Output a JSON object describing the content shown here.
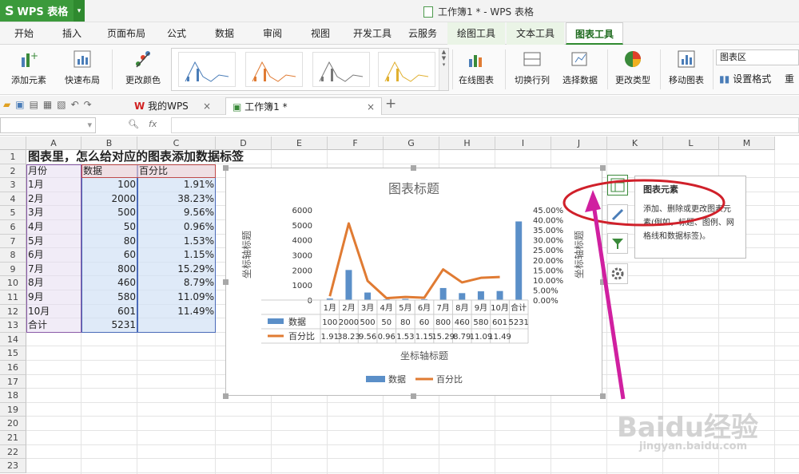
{
  "app": {
    "name": "WPS 表格",
    "window_title": "工作簿1 * - WPS 表格"
  },
  "menu_tabs": [
    "开始",
    "插入",
    "页面布局",
    "公式",
    "数据",
    "审阅",
    "视图",
    "开发工具",
    "云服务",
    "绘图工具",
    "文本工具",
    "图表工具"
  ],
  "ribbon": {
    "add_element": "添加元素",
    "quick_layout": "快速布局",
    "change_color": "更改颜色",
    "online_chart": "在线图表",
    "switch_row_col": "切换行列",
    "select_data": "选择数据",
    "change_type": "更改类型",
    "move_chart": "移动图表",
    "chart_area": "图表区",
    "set_format": "设置格式",
    "reset": "重"
  },
  "doc_tabs": {
    "my_wps": "我的WPS",
    "workbook": "工作簿1 *"
  },
  "formula": {
    "fx": "fx"
  },
  "columns": [
    "A",
    "B",
    "C",
    "D",
    "E",
    "F",
    "G",
    "H",
    "I",
    "J",
    "K",
    "L",
    "M"
  ],
  "rows": [
    "1",
    "2",
    "3",
    "4",
    "5",
    "6",
    "7",
    "8",
    "9",
    "10",
    "11",
    "12",
    "13",
    "14",
    "15",
    "16",
    "17",
    "18",
    "19",
    "20",
    "21",
    "22",
    "23"
  ],
  "sheet": {
    "title": "图表里，怎么给对应的图表添加数据标签",
    "headers": [
      "月份",
      "数据",
      "百分比"
    ],
    "data": [
      [
        "1月",
        "100",
        "1.91%"
      ],
      [
        "2月",
        "2000",
        "38.23%"
      ],
      [
        "3月",
        "500",
        "9.56%"
      ],
      [
        "4月",
        "50",
        "0.96%"
      ],
      [
        "5月",
        "80",
        "1.53%"
      ],
      [
        "6月",
        "60",
        "1.15%"
      ],
      [
        "7月",
        "800",
        "15.29%"
      ],
      [
        "8月",
        "460",
        "8.79%"
      ],
      [
        "9月",
        "580",
        "11.09%"
      ],
      [
        "10月",
        "601",
        "11.49%"
      ],
      [
        "合计",
        "5231",
        ""
      ]
    ]
  },
  "chart_data": {
    "type": "bar",
    "title": "图表标题",
    "xlabel": "坐标轴标题",
    "ylabel": "坐标轴标题",
    "y2label": "坐标轴标题",
    "categories": [
      "1月",
      "2月",
      "3月",
      "4月",
      "5月",
      "6月",
      "7月",
      "8月",
      "9月",
      "10月",
      "合计"
    ],
    "ylim": [
      0,
      6000
    ],
    "yticks": [
      "6000",
      "5000",
      "4000",
      "3000",
      "2000",
      "1000",
      "0"
    ],
    "y2lim": [
      0,
      45
    ],
    "y2ticks": [
      "45.00%",
      "40.00%",
      "35.00%",
      "30.00%",
      "25.00%",
      "20.00%",
      "15.00%",
      "10.00%",
      "5.00%",
      "0.00%"
    ],
    "series": [
      {
        "name": "数据",
        "type": "bar",
        "color": "#5b8fc8",
        "values": [
          100,
          2000,
          500,
          50,
          80,
          60,
          800,
          460,
          580,
          601,
          5231
        ]
      },
      {
        "name": "百分比",
        "type": "line",
        "color": "#e07b33",
        "values": [
          1.91,
          38.23,
          9.56,
          0.96,
          1.53,
          1.15,
          15.29,
          8.79,
          11.09,
          11.49
        ]
      }
    ],
    "table_rows": [
      [
        "100",
        "2000",
        "500",
        "50",
        "80",
        "60",
        "800",
        "460",
        "580",
        "601",
        "5231"
      ],
      [
        "1.91",
        "38.23",
        "9.56",
        "0.96",
        "1.53",
        "1.15",
        "15.29",
        "8.79",
        "11.09",
        "11.49",
        ""
      ]
    ]
  },
  "tooltip": {
    "title": "图表元素",
    "body": "添加、删除或更改图表元素(例如，标题、图例、网格线和数据标签)。"
  },
  "watermark": {
    "main": "Baidu经验",
    "url": "jingyan.baidu.com"
  },
  "colors": {
    "accent": "#2f8a2f",
    "annotation": "#d02090",
    "circle": "#d0202a"
  }
}
